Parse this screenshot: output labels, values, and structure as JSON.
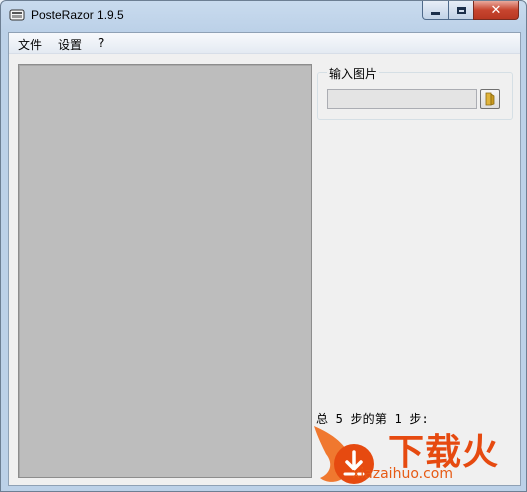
{
  "window": {
    "title": "PosteRazor 1.9.5",
    "close_glyph": "✕"
  },
  "menu": {
    "items": [
      "文件",
      "设置",
      "?"
    ]
  },
  "input_image": {
    "group_label": "输入图片",
    "path_value": "",
    "browse_icon": "folder-icon"
  },
  "status": {
    "step_text": "总 5 步的第 1 步:"
  },
  "watermark": {
    "brand_text": "下载火",
    "site_text": "xiazaihuo.com"
  },
  "colors": {
    "preview_bg": "#bdbdbd",
    "watermark": "#e64a10",
    "client_bg": "#f0f0f0"
  }
}
